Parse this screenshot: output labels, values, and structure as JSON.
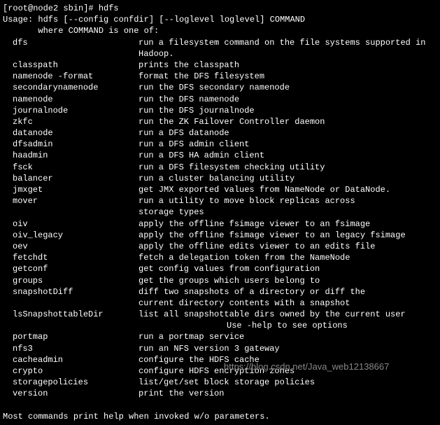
{
  "prompt": "[root@node2 sbin]# hdfs",
  "usage": "Usage: hdfs [--config confdir] [--loglevel loglevel] COMMAND",
  "where": "       where COMMAND is one of:",
  "commands": [
    {
      "name": "dfs",
      "desc": "run a filesystem command on the file systems supported in Hadoop."
    },
    {
      "name": "classpath",
      "desc": "prints the classpath"
    },
    {
      "name": "namenode -format",
      "desc": "format the DFS filesystem"
    },
    {
      "name": "secondarynamenode",
      "desc": "run the DFS secondary namenode"
    },
    {
      "name": "namenode",
      "desc": "run the DFS namenode"
    },
    {
      "name": "journalnode",
      "desc": "run the DFS journalnode"
    },
    {
      "name": "zkfc",
      "desc": "run the ZK Failover Controller daemon"
    },
    {
      "name": "datanode",
      "desc": "run a DFS datanode"
    },
    {
      "name": "dfsadmin",
      "desc": "run a DFS admin client"
    },
    {
      "name": "haadmin",
      "desc": "run a DFS HA admin client"
    },
    {
      "name": "fsck",
      "desc": "run a DFS filesystem checking utility"
    },
    {
      "name": "balancer",
      "desc": "run a cluster balancing utility"
    },
    {
      "name": "jmxget",
      "desc": "get JMX exported values from NameNode or DataNode."
    },
    {
      "name": "mover",
      "desc": "run a utility to move block replicas across",
      "cont": "storage types"
    },
    {
      "name": "oiv",
      "desc": "apply the offline fsimage viewer to an fsimage"
    },
    {
      "name": "oiv_legacy",
      "desc": "apply the offline fsimage viewer to an legacy fsimage"
    },
    {
      "name": "oev",
      "desc": "apply the offline edits viewer to an edits file"
    },
    {
      "name": "fetchdt",
      "desc": "fetch a delegation token from the NameNode"
    },
    {
      "name": "getconf",
      "desc": "get config values from configuration"
    },
    {
      "name": "groups",
      "desc": "get the groups which users belong to"
    },
    {
      "name": "snapshotDiff",
      "desc": "diff two snapshots of a directory or diff the",
      "cont": "current directory contents with a snapshot"
    },
    {
      "name": "lsSnapshottableDir",
      "desc": "list all snapshottable dirs owned by the current user",
      "help": "Use -help to see options"
    },
    {
      "name": "portmap",
      "desc": "run a portmap service"
    },
    {
      "name": "nfs3",
      "desc": "run an NFS version 3 gateway"
    },
    {
      "name": "cacheadmin",
      "desc": "configure the HDFS cache"
    },
    {
      "name": "crypto",
      "desc": "configure HDFS encryption zones"
    },
    {
      "name": "storagepolicies",
      "desc": "list/get/set block storage policies"
    },
    {
      "name": "version",
      "desc": "print the version"
    }
  ],
  "footer": "Most commands print help when invoked w/o parameters.",
  "watermark": "https://blog.csdn.net/Java_web12138667"
}
